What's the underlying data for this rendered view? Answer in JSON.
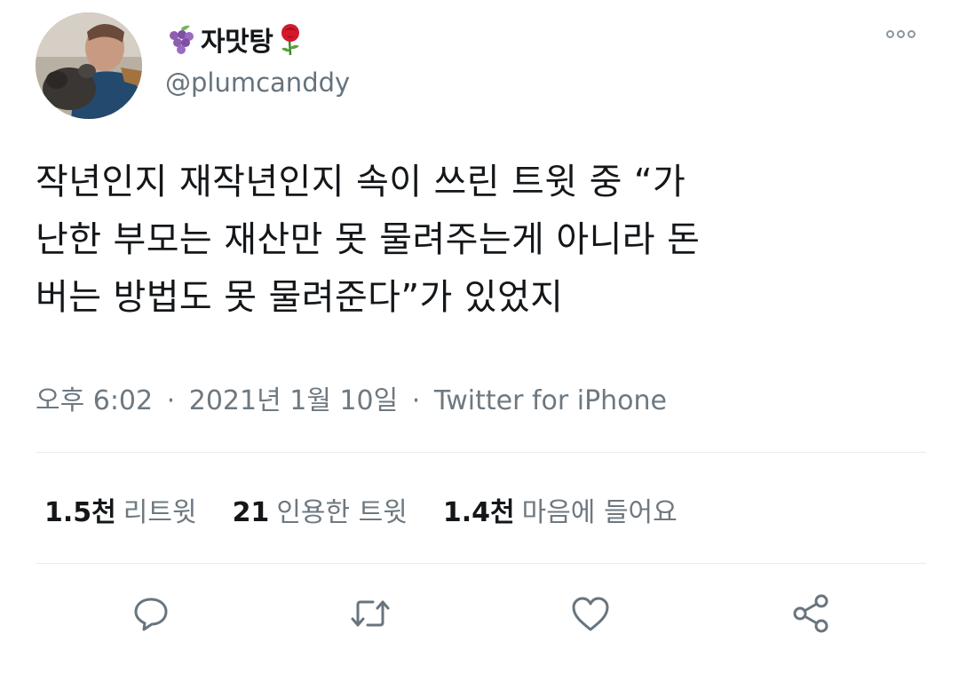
{
  "user": {
    "display_name": "자맛탕",
    "prefix_emoji": "grapes-emoji",
    "suffix_emoji": "rose-emoji",
    "handle": "@plumcanddy"
  },
  "tweet": {
    "lines": [
      "작년인지 재작년인지 속이 쓰린 트윗 중 “가",
      "난한 부모는 재산만 못 물려주는게 아니라 돈",
      "버는 방법도 못 물려준다”가 있었지"
    ]
  },
  "meta": {
    "time": "오후 6:02",
    "date": "2021년 1월 10일",
    "source": "Twitter for iPhone",
    "separator": "·"
  },
  "stats": {
    "retweets": {
      "count": "1.5천",
      "label": "리트윗"
    },
    "quotes": {
      "count": "21",
      "label": "인용한 트윗"
    },
    "likes": {
      "count": "1.4천",
      "label": "마음에 들어요"
    }
  },
  "actions": {
    "reply_icon": "reply-icon",
    "retweet_icon": "retweet-icon",
    "like_icon": "heart-icon",
    "share_icon": "share-icon"
  },
  "colors": {
    "text_primary": "#14171a",
    "text_secondary": "#6e7880",
    "divider": "#e6ecf0",
    "icon": "#68757f"
  }
}
